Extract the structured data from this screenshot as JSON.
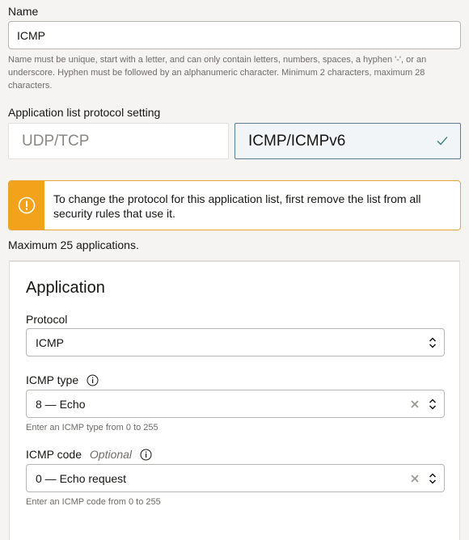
{
  "name_field": {
    "label": "Name",
    "value": "ICMP",
    "help": "Name must be unique, start with a letter, and can only contain letters, numbers, spaces, a hyphen '-', or an underscore. Hyphen must be followed by an alphanumeric character. Minimum 2 characters, maximum 28 characters."
  },
  "protocol_setting": {
    "label": "Application list protocol setting",
    "options": [
      "UDP/TCP",
      "ICMP/ICMPv6"
    ],
    "selected": "ICMP/ICMPv6"
  },
  "warning": {
    "text": "To change the protocol for this application list, first remove the list from all security rules that use it."
  },
  "max_text": "Maximum 25 applications.",
  "application": {
    "title": "Application",
    "protocol": {
      "label": "Protocol",
      "value": "ICMP"
    },
    "icmp_type": {
      "label": "ICMP type",
      "value": "8 — Echo",
      "help": "Enter an ICMP type from 0 to 255"
    },
    "icmp_code": {
      "label": "ICMP code",
      "optional": "Optional",
      "value": "0 — Echo request",
      "help": "Enter an ICMP code from 0 to 255"
    }
  },
  "colors": {
    "warning": "#f3a21c",
    "selected_border": "#5a7d93",
    "check": "#2d7a74"
  }
}
